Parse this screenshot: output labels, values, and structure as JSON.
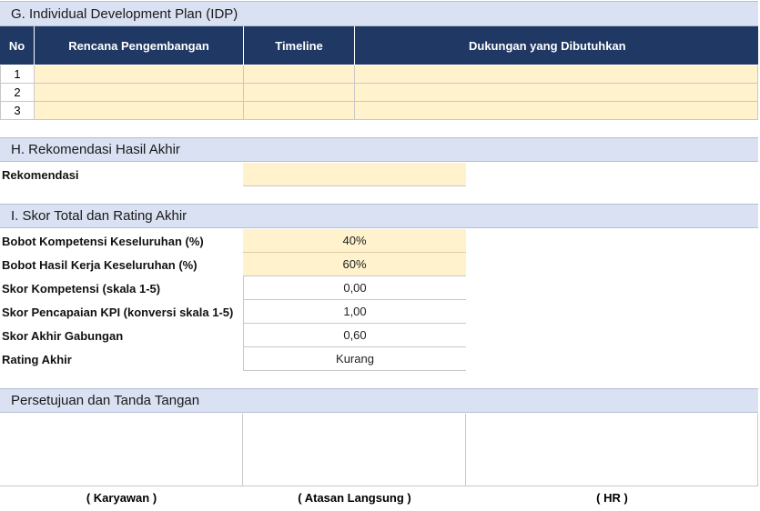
{
  "idp": {
    "title": "G. Individual Development Plan (IDP)",
    "headers": [
      "No",
      "Rencana Pengembangan",
      "Timeline",
      "Dukungan yang Dibutuhkan"
    ],
    "rows": [
      "1",
      "2",
      "3"
    ]
  },
  "rekomendasi": {
    "title": "H. Rekomendasi Hasil Akhir",
    "label": "Rekomendasi",
    "value": ""
  },
  "skor": {
    "title": "I. Skor Total dan Rating Akhir",
    "items": [
      {
        "label": "Bobot Kompetensi Keseluruhan (%)",
        "value": "40%"
      },
      {
        "label": "Bobot Hasil Kerja Keseluruhan (%)",
        "value": "60%"
      },
      {
        "label": "Skor Kompetensi (skala 1-5)",
        "value": "0,00"
      },
      {
        "label": "Skor Pencapaian KPI (konversi skala 1-5)",
        "value": "1,00"
      },
      {
        "label": "Skor Akhir Gabungan",
        "value": "0,60"
      },
      {
        "label": "Rating Akhir",
        "value": "Kurang"
      }
    ]
  },
  "persetujuan": {
    "title": "Persetujuan dan Tanda Tangan",
    "signers": [
      "( Karyawan )",
      "( Atasan Langsung )",
      "( HR )"
    ]
  }
}
